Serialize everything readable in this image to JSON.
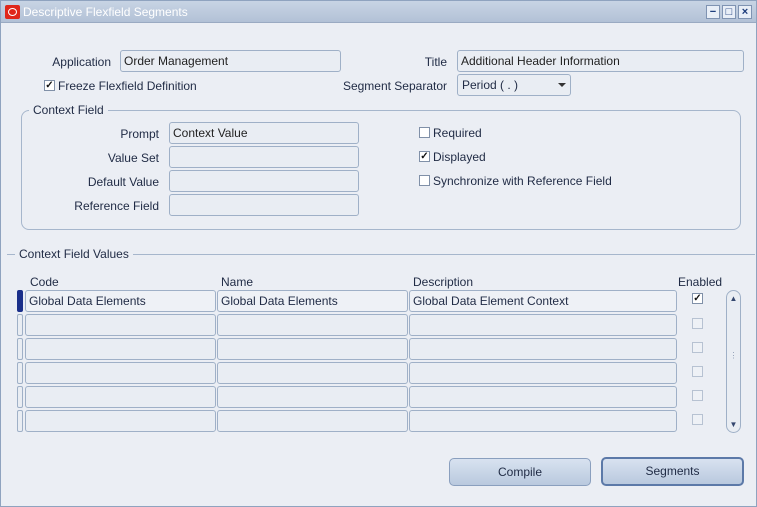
{
  "window": {
    "title": "Descriptive Flexfield Segments"
  },
  "header": {
    "application_label": "Application",
    "application_value": "Order Management",
    "title_label": "Title",
    "title_value": "Additional Header Information",
    "freeze_label": "Freeze Flexfield Definition",
    "freeze_checked": true,
    "separator_label": "Segment Separator",
    "separator_value": "Period ( . )"
  },
  "context_field": {
    "group_title": "Context Field",
    "prompt_label": "Prompt",
    "prompt_value": "Context Value",
    "value_set_label": "Value Set",
    "value_set_value": "",
    "default_value_label": "Default Value",
    "default_value_value": "",
    "reference_field_label": "Reference Field",
    "reference_field_value": "",
    "required_label": "Required",
    "required_checked": false,
    "displayed_label": "Displayed",
    "displayed_checked": true,
    "sync_label": "Synchronize with Reference Field",
    "sync_checked": false
  },
  "context_values": {
    "group_title": "Context Field Values",
    "columns": {
      "code": "Code",
      "name": "Name",
      "description": "Description",
      "enabled": "Enabled"
    },
    "rows": [
      {
        "code": "Global Data Elements",
        "name": "Global Data Elements",
        "description": "Global Data Element Context",
        "enabled": true
      },
      {
        "code": "",
        "name": "",
        "description": "",
        "enabled": false
      },
      {
        "code": "",
        "name": "",
        "description": "",
        "enabled": false
      },
      {
        "code": "",
        "name": "",
        "description": "",
        "enabled": false
      },
      {
        "code": "",
        "name": "",
        "description": "",
        "enabled": false
      },
      {
        "code": "",
        "name": "",
        "description": "",
        "enabled": false
      }
    ]
  },
  "buttons": {
    "compile": "Compile",
    "segments": "Segments"
  },
  "icons": {
    "app": "oracle-icon",
    "minimize": "minimize-icon",
    "maximize": "maximize-icon",
    "close": "close-icon"
  }
}
